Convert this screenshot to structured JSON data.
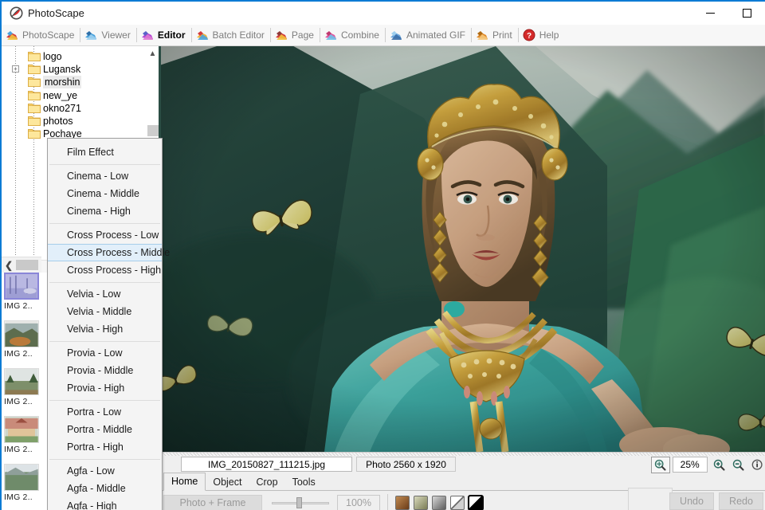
{
  "window": {
    "title": "PhotoScape",
    "logo_icon": "photoscape-logo-icon",
    "minimize_label": "minimize-icon",
    "maximize_label": "maximize-icon"
  },
  "modulebar": {
    "items": [
      {
        "label": "PhotoScape",
        "icon": "photoscape-module-icon",
        "active": false
      },
      {
        "label": "Viewer",
        "icon": "viewer-module-icon",
        "active": false
      },
      {
        "label": "Editor",
        "icon": "editor-module-icon",
        "active": true
      },
      {
        "label": "Batch Editor",
        "icon": "batch-editor-module-icon",
        "active": false
      },
      {
        "label": "Page",
        "icon": "page-module-icon",
        "active": false
      },
      {
        "label": "Combine",
        "icon": "combine-module-icon",
        "active": false
      },
      {
        "label": "Animated GIF",
        "icon": "animated-gif-module-icon",
        "active": false
      },
      {
        "label": "Print",
        "icon": "print-module-icon",
        "active": false
      },
      {
        "label": "Help",
        "icon": "help-module-icon",
        "active": false
      }
    ]
  },
  "folder_tree": {
    "scroll_up_icon": "chevron-up-icon",
    "items": [
      {
        "label": "logo",
        "expandable": false,
        "selected": false
      },
      {
        "label": "Lugansk",
        "expandable": true,
        "selected": false
      },
      {
        "label": "morshin",
        "expandable": false,
        "selected": true
      },
      {
        "label": "new_ye",
        "expandable": false,
        "selected": false
      },
      {
        "label": "okno271",
        "expandable": false,
        "selected": false
      },
      {
        "label": "photos",
        "expandable": false,
        "selected": false
      },
      {
        "label": "Pochaye",
        "expandable": false,
        "selected": false
      }
    ]
  },
  "thumbnails": {
    "collapse_icon": "chevron-left-icon",
    "items": [
      {
        "caption": "IMG  2..",
        "selected": true
      },
      {
        "caption": "IMG  2..",
        "selected": false
      },
      {
        "caption": "IMG  2..",
        "selected": false
      },
      {
        "caption": "IMG  2..",
        "selected": false
      },
      {
        "caption": "IMG  2..",
        "selected": false
      }
    ]
  },
  "context_menu": {
    "header": "Film Effect",
    "groups": [
      {
        "items": [
          {
            "label": "Cinema - Low",
            "highlighted": false
          },
          {
            "label": "Cinema - Middle",
            "highlighted": false
          },
          {
            "label": "Cinema - High",
            "highlighted": false
          }
        ]
      },
      {
        "items": [
          {
            "label": "Cross Process - Low",
            "highlighted": false
          },
          {
            "label": "Cross Process - Middle",
            "highlighted": true
          },
          {
            "label": "Cross Process - High",
            "highlighted": false
          }
        ]
      },
      {
        "items": [
          {
            "label": "Velvia - Low",
            "highlighted": false
          },
          {
            "label": "Velvia - Middle",
            "highlighted": false
          },
          {
            "label": "Velvia - High",
            "highlighted": false
          }
        ]
      },
      {
        "items": [
          {
            "label": "Provia - Low",
            "highlighted": false
          },
          {
            "label": "Provia - Middle",
            "highlighted": false
          },
          {
            "label": "Provia - High",
            "highlighted": false
          }
        ]
      },
      {
        "items": [
          {
            "label": "Portra - Low",
            "highlighted": false
          },
          {
            "label": "Portra - Middle",
            "highlighted": false
          },
          {
            "label": "Portra - High",
            "highlighted": false
          }
        ]
      },
      {
        "items": [
          {
            "label": "Agfa - Low",
            "highlighted": false
          },
          {
            "label": "Agfa - Middle",
            "highlighted": false
          },
          {
            "label": "Agfa - High",
            "highlighted": false
          }
        ]
      }
    ]
  },
  "canvas": {
    "alt": "Woman wearing a gold crown, teal off-shoulder dress and layered gold necklaces, standing before misty green mountains with yellow butterflies"
  },
  "infobar": {
    "filename": "IMG_20150827_111215.jpg",
    "dimensions": "Photo 2560 x 1920",
    "zoom_value": "25%",
    "fit_icon": "zoom-fit-icon",
    "zoom_in_icon": "zoom-in-icon",
    "zoom_out_icon": "zoom-out-icon",
    "info_icon": "info-icon"
  },
  "toolpanel": {
    "tabs": [
      {
        "label": "Home",
        "active": true
      },
      {
        "label": "Object",
        "active": false
      },
      {
        "label": "Crop",
        "active": false
      },
      {
        "label": "Tools",
        "active": false
      }
    ],
    "frame_button": "Photo + Frame",
    "opacity_value": "100%",
    "swatches": [
      {
        "name": "sepia-swatch",
        "selected": false
      },
      {
        "name": "olive-swatch",
        "selected": false
      },
      {
        "name": "gray-swatch",
        "selected": false
      },
      {
        "name": "gray-diagonal-swatch",
        "selected": false
      },
      {
        "name": "bw-diagonal-swatch",
        "selected": true
      }
    ],
    "undo_label": "Undo",
    "redo_label": "Redo"
  },
  "colors": {
    "accent": "#0a7bd4",
    "menu_highlight": "#e2effa",
    "panel": "#efefef",
    "thumb_selected": "#8a86d8"
  }
}
